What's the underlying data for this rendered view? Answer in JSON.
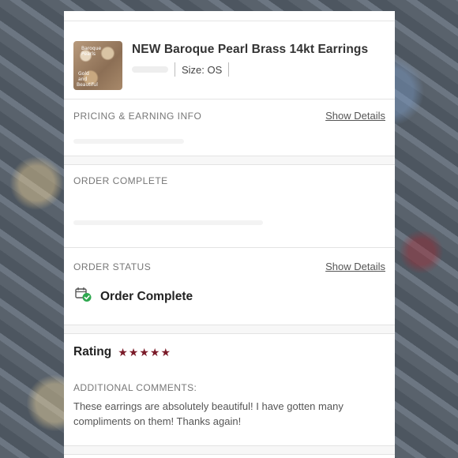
{
  "item": {
    "title": "NEW Baroque Pearl Brass 14kt Earrings",
    "size": "Size: OS",
    "thumb_text": [
      "Baroque",
      "Pearls",
      "Gold",
      "and",
      "Beautiful"
    ]
  },
  "pricing": {
    "label": "PRICING & EARNING INFO",
    "show_details": "Show Details"
  },
  "order_complete": {
    "label": "ORDER COMPLETE"
  },
  "order_status": {
    "label": "ORDER STATUS",
    "show_details": "Show Details",
    "status": "Order Complete",
    "status_icon": "package-check-icon"
  },
  "rating": {
    "label": "Rating",
    "stars": 5,
    "star_color": "#7a1a28",
    "comments_label": "ADDITIONAL COMMENTS:",
    "comments": "These earrings are absolutely beautiful! I have gotten many compliments on them! Thanks again!"
  },
  "colors": {
    "success": "#2fa84f",
    "accent": "#7a1a28"
  }
}
